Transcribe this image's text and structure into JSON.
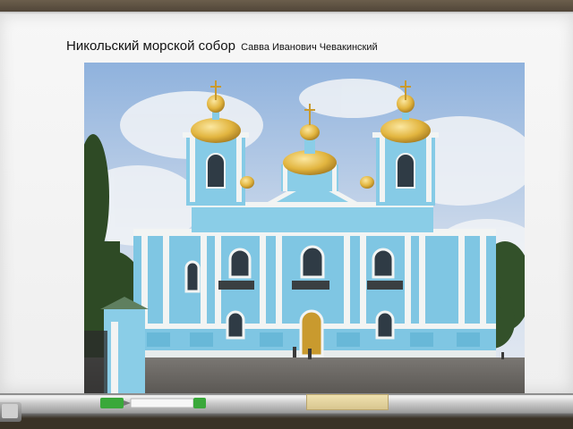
{
  "slide": {
    "title": "Никольский морской собор",
    "subtitle": "Савва Иванович Чевакинский"
  },
  "photo": {
    "subject": "cathedral-photo",
    "colors": {
      "sky": "#b9cde6",
      "facade": "#7fc6e3",
      "white_trim": "#f2f4f3",
      "gold_dome": "#e2b53f",
      "ground": "#6f6c68",
      "trees": "#2e4a25"
    }
  },
  "board": {
    "background": "#f4f4f4",
    "tray_color": "#cfcfcf",
    "marker_cap_color": "#3aa83a"
  }
}
